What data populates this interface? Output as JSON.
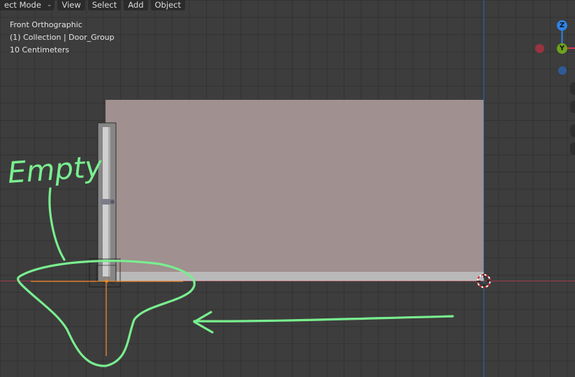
{
  "header": {
    "mode_label": "ect Mode",
    "menus": [
      "View",
      "Select",
      "Add",
      "Object"
    ]
  },
  "overlay": {
    "view_name": "Front Orthographic",
    "collection": "(1) Collection | Door_Group",
    "grid_scale": "10 Centimeters"
  },
  "gizmo": {
    "z_label": "Z",
    "y_label": "Y",
    "colors": {
      "z": "#2f83e6",
      "y": "#6ea31c",
      "x_neg": "#9a3340",
      "z_neg": "#2f5a98"
    }
  },
  "annotation": {
    "text": "Empty",
    "stroke_color": "#79ee8f"
  },
  "colors": {
    "background": "#3d3d3d",
    "axis_x": "#a33b4c",
    "axis_z": "#2d5fa0",
    "empty_orange": "#e88a2c",
    "door_panel": "#a0908f",
    "frame": "#c9c9c9"
  }
}
